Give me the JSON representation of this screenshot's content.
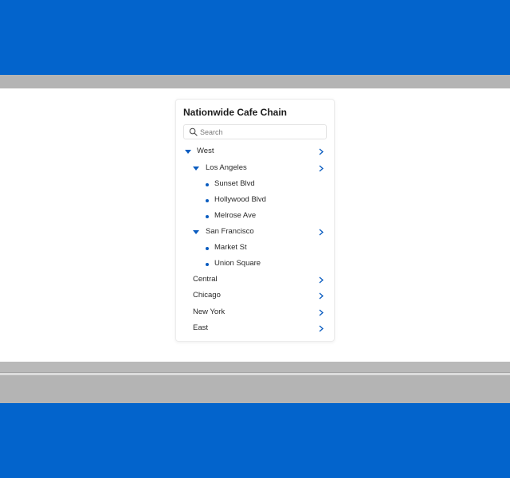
{
  "panel": {
    "title": "Nationwide Cafe Chain",
    "search": {
      "placeholder": "Search",
      "value": ""
    }
  },
  "tree": {
    "west": {
      "label": "West",
      "los_angeles": {
        "label": "Los Angeles",
        "items": [
          "Sunset Blvd",
          "Hollywood Blvd",
          "Melrose Ave"
        ]
      },
      "san_francisco": {
        "label": "San Francisco",
        "items": [
          "Market St",
          "Union Square"
        ]
      }
    },
    "central": {
      "label": "Central"
    },
    "chicago": {
      "label": "Chicago"
    },
    "new_york": {
      "label": "New York"
    },
    "east": {
      "label": "East"
    }
  },
  "icons": {
    "search": "search-icon",
    "expanded": "caret-down-icon",
    "navigate": "chevron-right-icon",
    "leaf": "bullet-icon"
  },
  "colors": {
    "brand_band": "#0364cc",
    "accent": "#0a5cc0",
    "grey_bar": "#b4b4b4"
  }
}
